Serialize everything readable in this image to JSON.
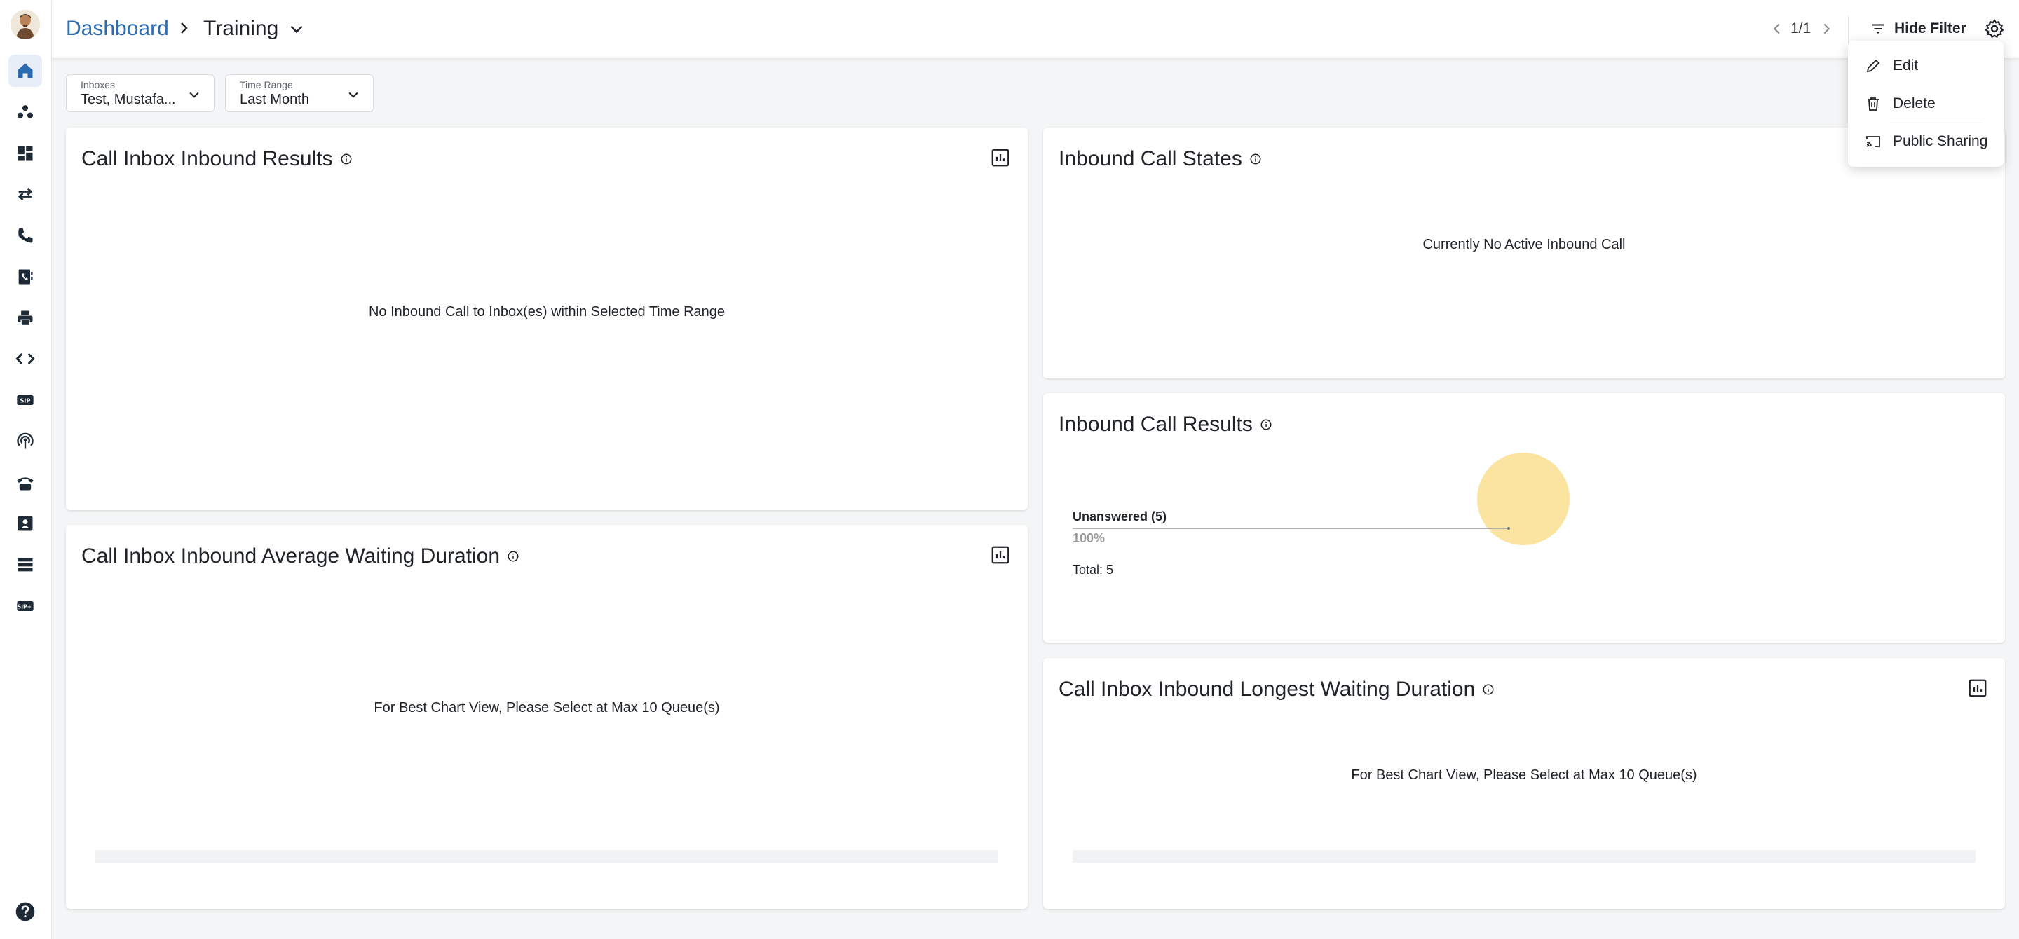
{
  "header": {
    "breadcrumb_root": "Dashboard",
    "breadcrumb_current": "Training",
    "pager": "1/1",
    "hide_filter_label": "Hide Filter"
  },
  "filters": {
    "inboxes": {
      "label": "Inboxes",
      "value": "Test, Mustafa..."
    },
    "time_range": {
      "label": "Time Range",
      "value": "Last Month"
    }
  },
  "menu": {
    "edit": "Edit",
    "delete": "Delete",
    "public_sharing": "Public Sharing"
  },
  "panels": {
    "call_inbox_inbound_results": {
      "title": "Call Inbox Inbound Results",
      "message": "No Inbound Call to Inbox(es) within Selected Time Range"
    },
    "inbound_call_states": {
      "title": "Inbound Call States",
      "message": "Currently No Active Inbound Call"
    },
    "inbound_call_results": {
      "title": "Inbound Call Results",
      "pie_label": "Unanswered (5)",
      "pie_percent": "100%",
      "total": "Total: 5"
    },
    "avg_waiting": {
      "title": "Call Inbox Inbound Average Waiting Duration",
      "message": "For Best Chart View, Please Select at Max 10 Queue(s)"
    },
    "longest_waiting": {
      "title": "Call Inbox Inbound Longest Waiting Duration",
      "message": "For Best Chart View, Please Select at Max 10 Queue(s)"
    }
  },
  "colors": {
    "accent": "#2b6cb0",
    "pie_unanswered": "#fbe3a0",
    "active_nav_bg": "#e7eef7"
  },
  "sidebar_icons": [
    "home-icon",
    "contacts-icon",
    "dashboard-icon",
    "transfer-icon",
    "phone-icon",
    "phonebook-icon",
    "fax-icon",
    "code-icon",
    "sip-icon",
    "broadcast-icon",
    "desk-phone-icon",
    "directory-icon",
    "queue-list-icon",
    "sip-trunk-icon",
    "help-icon"
  ]
}
